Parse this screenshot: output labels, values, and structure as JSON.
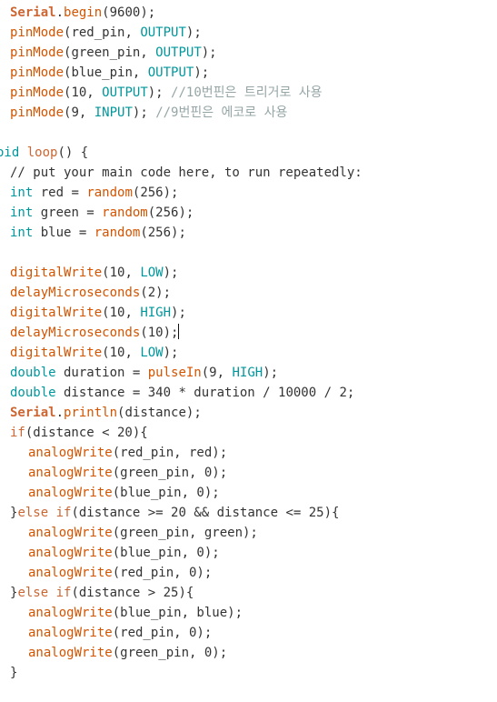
{
  "theme": {
    "keyword": "#cc6633",
    "function": "#d35400",
    "type": "#00979c",
    "constant": "#00979c",
    "comment": "#95a5a6",
    "text": "#333333",
    "background": "#ffffff"
  },
  "code": {
    "lines": [
      {
        "indent": 1,
        "tokens": [
          [
            "kwb",
            "Serial"
          ],
          [
            "plain",
            "."
          ],
          [
            "fn",
            "begin"
          ],
          [
            "plain",
            "(9600);"
          ]
        ]
      },
      {
        "indent": 1,
        "tokens": [
          [
            "fn",
            "pinMode"
          ],
          [
            "plain",
            "(red_pin, "
          ],
          [
            "const",
            "OUTPUT"
          ],
          [
            "plain",
            ");"
          ]
        ]
      },
      {
        "indent": 1,
        "tokens": [
          [
            "fn",
            "pinMode"
          ],
          [
            "plain",
            "(green_pin, "
          ],
          [
            "const",
            "OUTPUT"
          ],
          [
            "plain",
            ");"
          ]
        ]
      },
      {
        "indent": 1,
        "tokens": [
          [
            "fn",
            "pinMode"
          ],
          [
            "plain",
            "(blue_pin, "
          ],
          [
            "const",
            "OUTPUT"
          ],
          [
            "plain",
            ");"
          ]
        ]
      },
      {
        "indent": 1,
        "tokens": [
          [
            "fn",
            "pinMode"
          ],
          [
            "plain",
            "(10, "
          ],
          [
            "const",
            "OUTPUT"
          ],
          [
            "plain",
            "); "
          ],
          [
            "cm",
            "//10번핀은 트리거로 사용"
          ]
        ]
      },
      {
        "indent": 1,
        "tokens": [
          [
            "fn",
            "pinMode"
          ],
          [
            "plain",
            "(9, "
          ],
          [
            "const",
            "INPUT"
          ],
          [
            "plain",
            "); "
          ],
          [
            "cm",
            "//9번핀은 에코로 사용"
          ]
        ]
      },
      {
        "indent": 0,
        "tokens": []
      },
      {
        "indent": 0,
        "tokens": [
          [
            "type",
            "oid"
          ],
          [
            "plain",
            " "
          ],
          [
            "kw",
            "loop"
          ],
          [
            "plain",
            "() {"
          ]
        ]
      },
      {
        "indent": 1,
        "tokens": [
          [
            "plain",
            "// put your main code here, to run repeatedly:"
          ]
        ]
      },
      {
        "indent": 1,
        "tokens": [
          [
            "type",
            "int"
          ],
          [
            "plain",
            " red = "
          ],
          [
            "fn",
            "random"
          ],
          [
            "plain",
            "(256);"
          ]
        ]
      },
      {
        "indent": 1,
        "tokens": [
          [
            "type",
            "int"
          ],
          [
            "plain",
            " green = "
          ],
          [
            "fn",
            "random"
          ],
          [
            "plain",
            "(256);"
          ]
        ]
      },
      {
        "indent": 1,
        "tokens": [
          [
            "type",
            "int"
          ],
          [
            "plain",
            " blue = "
          ],
          [
            "fn",
            "random"
          ],
          [
            "plain",
            "(256);"
          ]
        ]
      },
      {
        "indent": 0,
        "tokens": []
      },
      {
        "indent": 1,
        "tokens": [
          [
            "fn",
            "digitalWrite"
          ],
          [
            "plain",
            "(10, "
          ],
          [
            "const",
            "LOW"
          ],
          [
            "plain",
            ");"
          ]
        ]
      },
      {
        "indent": 1,
        "tokens": [
          [
            "fn",
            "delayMicroseconds"
          ],
          [
            "plain",
            "(2);"
          ]
        ]
      },
      {
        "indent": 1,
        "tokens": [
          [
            "fn",
            "digitalWrite"
          ],
          [
            "plain",
            "(10, "
          ],
          [
            "const",
            "HIGH"
          ],
          [
            "plain",
            ");"
          ]
        ]
      },
      {
        "indent": 1,
        "caret": true,
        "tokens": [
          [
            "fn",
            "delayMicroseconds"
          ],
          [
            "plain",
            "(10);"
          ]
        ]
      },
      {
        "indent": 1,
        "tokens": [
          [
            "fn",
            "digitalWrite"
          ],
          [
            "plain",
            "(10, "
          ],
          [
            "const",
            "LOW"
          ],
          [
            "plain",
            ");"
          ]
        ]
      },
      {
        "indent": 1,
        "tokens": [
          [
            "type",
            "double"
          ],
          [
            "plain",
            " duration = "
          ],
          [
            "fn",
            "pulseIn"
          ],
          [
            "plain",
            "(9, "
          ],
          [
            "const",
            "HIGH"
          ],
          [
            "plain",
            ");"
          ]
        ]
      },
      {
        "indent": 1,
        "tokens": [
          [
            "type",
            "double"
          ],
          [
            "plain",
            " distance = 340 * duration / 10000 / 2;"
          ]
        ]
      },
      {
        "indent": 1,
        "tokens": [
          [
            "kwb",
            "Serial"
          ],
          [
            "plain",
            "."
          ],
          [
            "fn",
            "println"
          ],
          [
            "plain",
            "(distance);"
          ]
        ]
      },
      {
        "indent": 1,
        "tokens": [
          [
            "kw",
            "if"
          ],
          [
            "plain",
            "(distance < 20){"
          ]
        ]
      },
      {
        "indent": 2,
        "tokens": [
          [
            "fn",
            "analogWrite"
          ],
          [
            "plain",
            "(red_pin, red);"
          ]
        ]
      },
      {
        "indent": 2,
        "tokens": [
          [
            "fn",
            "analogWrite"
          ],
          [
            "plain",
            "(green_pin, 0);"
          ]
        ]
      },
      {
        "indent": 2,
        "tokens": [
          [
            "fn",
            "analogWrite"
          ],
          [
            "plain",
            "(blue_pin, 0);"
          ]
        ]
      },
      {
        "indent": 1,
        "tokens": [
          [
            "plain",
            "}"
          ],
          [
            "kw",
            "else"
          ],
          [
            "plain",
            " "
          ],
          [
            "kw",
            "if"
          ],
          [
            "plain",
            "(distance >= 20 && distance <= 25){"
          ]
        ]
      },
      {
        "indent": 2,
        "tokens": [
          [
            "fn",
            "analogWrite"
          ],
          [
            "plain",
            "(green_pin, green);"
          ]
        ]
      },
      {
        "indent": 2,
        "tokens": [
          [
            "fn",
            "analogWrite"
          ],
          [
            "plain",
            "(blue_pin, 0);"
          ]
        ]
      },
      {
        "indent": 2,
        "tokens": [
          [
            "fn",
            "analogWrite"
          ],
          [
            "plain",
            "(red_pin, 0);"
          ]
        ]
      },
      {
        "indent": 1,
        "tokens": [
          [
            "plain",
            "}"
          ],
          [
            "kw",
            "else"
          ],
          [
            "plain",
            " "
          ],
          [
            "kw",
            "if"
          ],
          [
            "plain",
            "(distance > 25){"
          ]
        ]
      },
      {
        "indent": 2,
        "tokens": [
          [
            "fn",
            "analogWrite"
          ],
          [
            "plain",
            "(blue_pin, blue);"
          ]
        ]
      },
      {
        "indent": 2,
        "tokens": [
          [
            "fn",
            "analogWrite"
          ],
          [
            "plain",
            "(red_pin, 0);"
          ]
        ]
      },
      {
        "indent": 2,
        "tokens": [
          [
            "fn",
            "analogWrite"
          ],
          [
            "plain",
            "(green_pin, 0);"
          ]
        ]
      },
      {
        "indent": 1,
        "tokens": [
          [
            "plain",
            "}"
          ]
        ]
      }
    ]
  }
}
